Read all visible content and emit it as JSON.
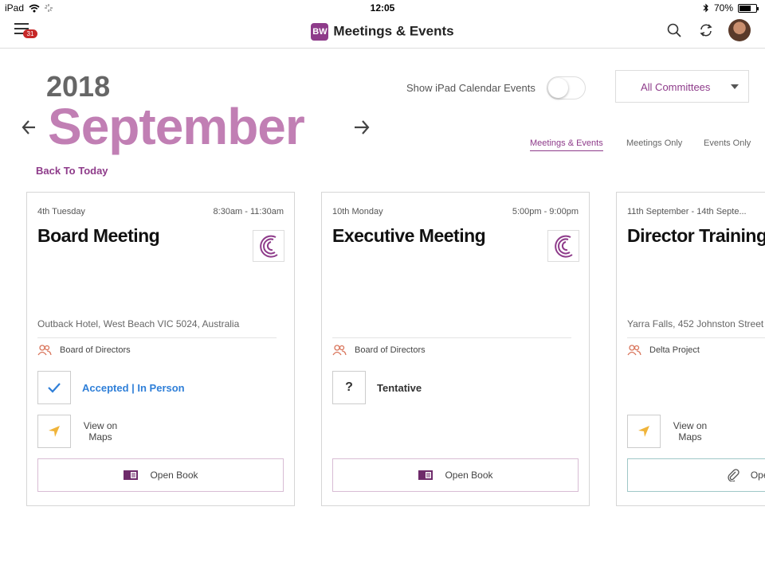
{
  "status_bar": {
    "device": "iPad",
    "time": "12:05",
    "battery": "70%",
    "battery_level": 0.7
  },
  "navbar": {
    "logo_text": "BW",
    "title": "Meetings & Events",
    "menu_badge": "31"
  },
  "calendar": {
    "year": "2018",
    "month": "September",
    "back_to_today": "Back To Today"
  },
  "controls": {
    "toggle_label": "Show iPad Calendar Events",
    "toggle_on": false,
    "committee_select": "All Committees",
    "filters": [
      "Meetings & Events",
      "Meetings Only",
      "Events Only"
    ],
    "active_filter": "Meetings & Events"
  },
  "colors": {
    "accent": "#8e3b8a",
    "month": "#c17fb4",
    "accepted": "#2f7fd8",
    "maps_arrow": "#f0b43a",
    "group_icon": "#d9755b"
  },
  "cards": [
    {
      "date": "4th Tuesday",
      "time": "8:30am - 11:30am",
      "title": "Board Meeting",
      "location": "Outback Hotel, West Beach VIC 5024, Australia",
      "group": "Board of Directors",
      "status": "Accepted | In Person",
      "status_icon": "check-icon",
      "maps_label": "View on Maps",
      "action_label": "Open Book",
      "action_icon": "book-icon"
    },
    {
      "date": "10th Monday",
      "time": "5:00pm - 9:00pm",
      "title": "Executive Meeting",
      "location": "",
      "group": "Board of Directors",
      "status": "Tentative",
      "status_icon": "question-icon",
      "maps_label": "",
      "action_label": "Open Book",
      "action_icon": "book-icon"
    },
    {
      "date": "11th September - 14th Septe...",
      "time": "",
      "title": "Director Training Workshop",
      "location": "Yarra Falls, 452 Johnston Street",
      "group": "Delta Project",
      "status": "",
      "maps_label": "View on Maps",
      "action_label": "Open",
      "action_icon": "paperclip-icon"
    }
  ]
}
